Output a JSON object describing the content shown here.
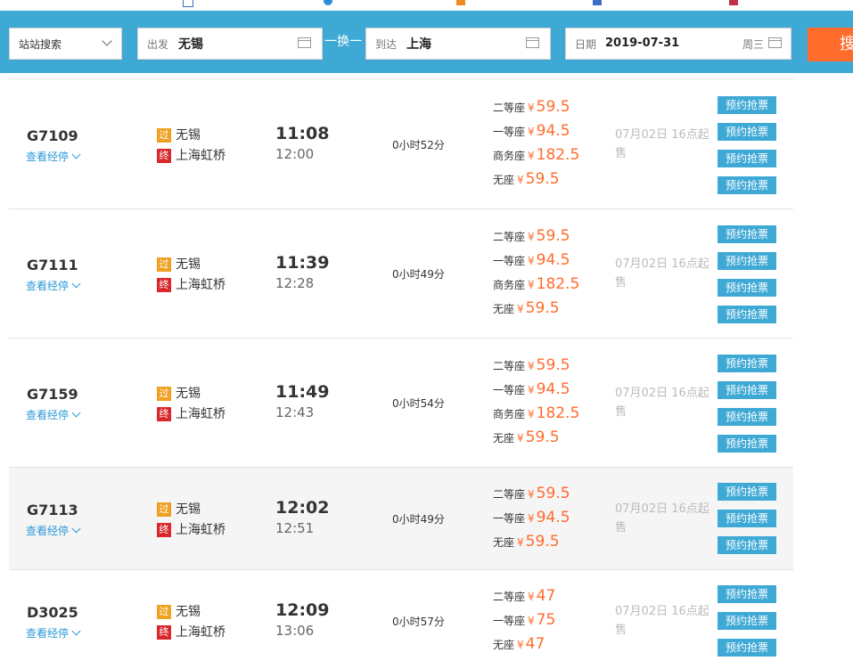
{
  "bookmarks": [],
  "search": {
    "mode": "站站搜索",
    "from_label": "出发",
    "from_value": "无锡",
    "swap_label": "一换一",
    "to_label": "到达",
    "to_value": "上海",
    "date_label": "日期",
    "date_value": "2019-07-31",
    "weekday": "周三",
    "search_button": "搜"
  },
  "trains": [
    {
      "number": "G7109",
      "stops_link": "查看经停",
      "pass_tag": "过",
      "from_station": "无锡",
      "end_tag": "终",
      "to_station": "上海虹桥",
      "depart": "11:08",
      "arrive": "12:00",
      "duration": "0小时52分",
      "seats": [
        {
          "name": "二等座",
          "currency": "¥",
          "price": "59.5"
        },
        {
          "name": "一等座",
          "currency": "¥",
          "price": "94.5"
        },
        {
          "name": "商务座",
          "currency": "¥",
          "price": "182.5"
        },
        {
          "name": "无座",
          "currency": "¥",
          "price": "59.5"
        }
      ],
      "sale_note": "07月02日 16点起售",
      "book_label": "预约抢票"
    },
    {
      "number": "G7111",
      "stops_link": "查看经停",
      "pass_tag": "过",
      "from_station": "无锡",
      "end_tag": "终",
      "to_station": "上海虹桥",
      "depart": "11:39",
      "arrive": "12:28",
      "duration": "0小时49分",
      "seats": [
        {
          "name": "二等座",
          "currency": "¥",
          "price": "59.5"
        },
        {
          "name": "一等座",
          "currency": "¥",
          "price": "94.5"
        },
        {
          "name": "商务座",
          "currency": "¥",
          "price": "182.5"
        },
        {
          "name": "无座",
          "currency": "¥",
          "price": "59.5"
        }
      ],
      "sale_note": "07月02日 16点起售",
      "book_label": "预约抢票"
    },
    {
      "number": "G7159",
      "stops_link": "查看经停",
      "pass_tag": "过",
      "from_station": "无锡",
      "end_tag": "终",
      "to_station": "上海虹桥",
      "depart": "11:49",
      "arrive": "12:43",
      "duration": "0小时54分",
      "seats": [
        {
          "name": "二等座",
          "currency": "¥",
          "price": "59.5"
        },
        {
          "name": "一等座",
          "currency": "¥",
          "price": "94.5"
        },
        {
          "name": "商务座",
          "currency": "¥",
          "price": "182.5"
        },
        {
          "name": "无座",
          "currency": "¥",
          "price": "59.5"
        }
      ],
      "sale_note": "07月02日 16点起售",
      "book_label": "预约抢票"
    },
    {
      "number": "G7113",
      "stops_link": "查看经停",
      "pass_tag": "过",
      "from_station": "无锡",
      "end_tag": "终",
      "to_station": "上海虹桥",
      "depart": "12:02",
      "arrive": "12:51",
      "duration": "0小时49分",
      "seats": [
        {
          "name": "二等座",
          "currency": "¥",
          "price": "59.5"
        },
        {
          "name": "一等座",
          "currency": "¥",
          "price": "94.5"
        },
        {
          "name": "无座",
          "currency": "¥",
          "price": "59.5"
        }
      ],
      "sale_note": "07月02日 16点起售",
      "book_label": "预约抢票"
    },
    {
      "number": "D3025",
      "stops_link": "查看经停",
      "pass_tag": "过",
      "from_station": "无锡",
      "end_tag": "终",
      "to_station": "上海虹桥",
      "depart": "12:09",
      "arrive": "13:06",
      "duration": "0小时57分",
      "seats": [
        {
          "name": "二等座",
          "currency": "¥",
          "price": "47"
        },
        {
          "name": "一等座",
          "currency": "¥",
          "price": "75"
        },
        {
          "name": "无座",
          "currency": "¥",
          "price": "47"
        }
      ],
      "sale_note": "07月02日 16点起售",
      "book_label": "预约抢票"
    }
  ],
  "colors": {
    "header_bg": "#3fa9d6",
    "price": "#ff6c2c",
    "search_button": "#ff6c2c",
    "link": "#2c9ad8",
    "pass_tag": "#f0a020",
    "end_tag": "#d8282c"
  }
}
